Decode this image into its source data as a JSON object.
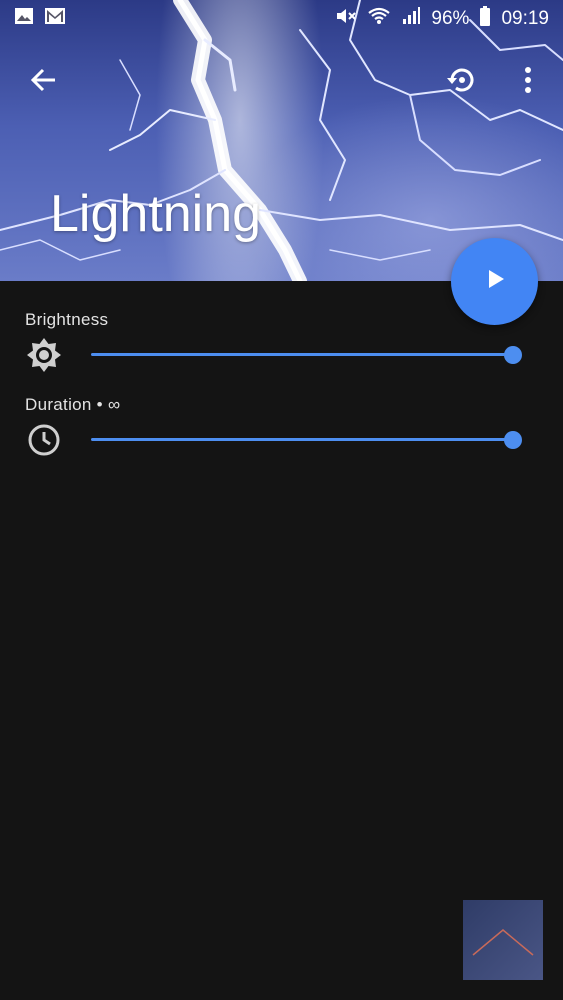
{
  "status_bar": {
    "battery": "96%",
    "time": "09:19",
    "left_icons": [
      "gallery-icon",
      "gmail-icon"
    ],
    "right_icons": [
      "mute-icon",
      "wifi-icon",
      "signal-icon",
      "battery-icon"
    ]
  },
  "app_bar": {
    "back_icon": "back-arrow-icon",
    "restore_icon": "restore-icon",
    "more_icon": "more-vert-icon"
  },
  "header": {
    "title": "Lightning"
  },
  "fab": {
    "icon": "play-icon",
    "color": "#4285f4"
  },
  "settings": {
    "brightness": {
      "label": "Brightness",
      "icon": "brightness-icon",
      "value": 1.0
    },
    "duration": {
      "label": "Duration • ∞",
      "icon": "clock-icon",
      "value": 1.0
    }
  },
  "colors": {
    "accent": "#4d8ef0",
    "background": "#141414"
  }
}
